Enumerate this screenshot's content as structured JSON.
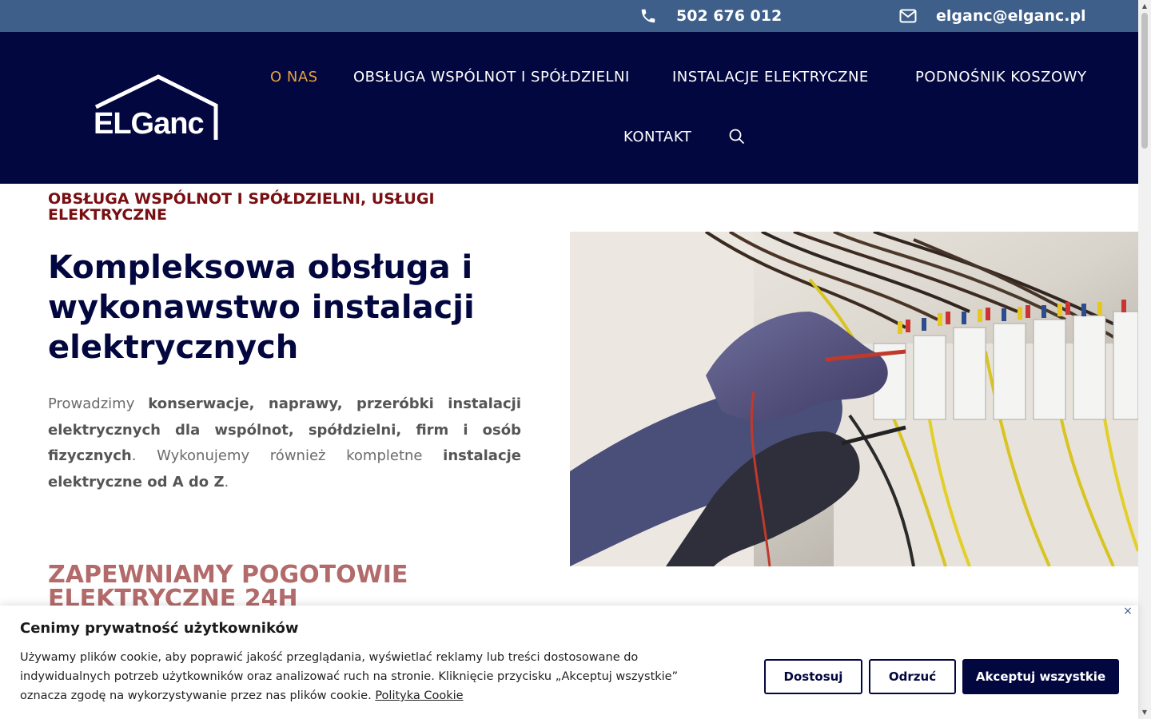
{
  "topbar": {
    "phone": "502 676 012",
    "email": "elganc@elganc.pl",
    "phone_icon": "phone-icon",
    "email_icon": "envelope-icon"
  },
  "header": {
    "logo_text": "ELGanc",
    "nav": [
      {
        "label": "O NAS",
        "active": true
      },
      {
        "label": "OBSŁUGA WSPÓLNOT I SPÓŁDZIELNI",
        "active": false
      },
      {
        "label": "INSTALACJE ELEKTRYCZNE",
        "active": false
      },
      {
        "label": "PODNOŚNIK KOSZOWY",
        "active": false
      },
      {
        "label": "KONTAKT",
        "active": false
      }
    ],
    "search_icon": "search-icon"
  },
  "hero": {
    "eyebrow": "OBSŁUGA WSPÓLNOT I SPÓŁDZIELNI, USŁUGI ELEKTRYCZNE",
    "headline": "Kompleksowa obsługa i wykonawstwo instalacji elektrycznych",
    "desc_1": "Prowadzimy ",
    "desc_2": "konserwacje, naprawy, przeróbki instalacji elektrycznych dla wspólnot, spółdzielni, firm i osób fizycznych",
    "desc_3": ". Wykonujemy również kompletne ",
    "desc_4": "instalacje elektryczne od A do Z",
    "desc_5": ".",
    "section2_title": "ZAPEWNIAMY POGOTOWIE ELEKTRYCZNE 24H"
  },
  "cookie": {
    "title": "Cenimy prywatność użytkowników",
    "text": "Używamy plików cookie, aby poprawić jakość przeglądania, wyświetlać reklamy lub treści dostosowane do indywidualnych potrzeb użytkowników oraz analizować ruch na stronie. Kliknięcie przycisku „Akceptuj wszystkie” oznacza zgodę na wykorzystywanie przez nas plików cookie. ",
    "policy_link": "Polityka Cookie",
    "customize": "Dostosuj",
    "reject": "Odrzuć",
    "accept": "Akceptuj wszystkie",
    "close": "×"
  },
  "colors": {
    "topbar": "#3d5f8a",
    "header": "#03073f",
    "active_nav": "#e8a23c",
    "eyebrow": "#7a0f12",
    "headline": "#03073f",
    "section2": "#b36a6a"
  }
}
